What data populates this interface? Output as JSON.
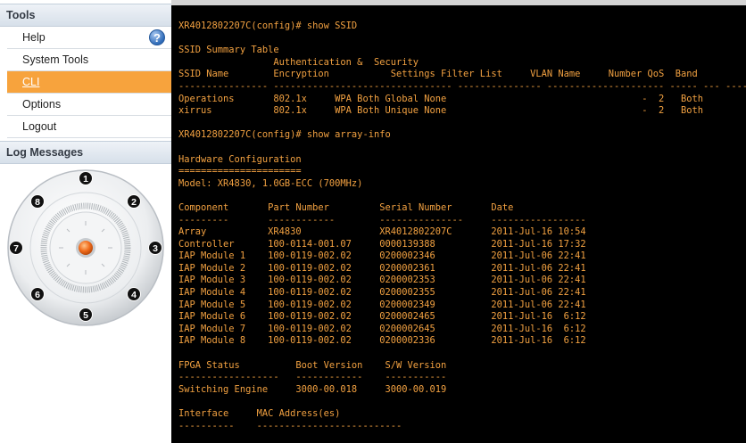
{
  "sidebar": {
    "tools_header": "Tools",
    "menu": [
      {
        "label": "Help"
      },
      {
        "label": "System Tools"
      },
      {
        "label": "CLI"
      },
      {
        "label": "Options"
      },
      {
        "label": "Logout"
      }
    ],
    "log_header": "Log Messages",
    "help_icon_glyph": "?",
    "array_ports": [
      "1",
      "2",
      "3",
      "4",
      "5",
      "6",
      "7",
      "8"
    ]
  },
  "colors": {
    "terminal_bg": "#000000",
    "terminal_fg": "#f2a141",
    "menu_active": "#f7a33d"
  },
  "terminal": {
    "lines": [
      "XR4012802207C(config)# show SSID",
      "",
      "SSID Summary Table",
      "                 Authentication &  Security",
      "SSID Name        Encryption           Settings Filter List     VLAN Name     Number QoS  Band",
      "---------------- -------------------------------- --------------- --------------------- ----- --- ------",
      "Operations       802.1x     WPA Both Global None                                   -  2   Both",
      "xirrus           802.1x     WPA Both Unique None                                   -  2   Both",
      "",
      "XR4012802207C(config)# show array-info",
      "",
      "Hardware Configuration",
      "======================",
      "Model: XR4830, 1.0GB-ECC (700MHz)",
      "",
      "Component       Part Number         Serial Number       Date",
      "---------       ------------        ---------------     -----------------",
      "Array           XR4830              XR4012802207C       2011-Jul-16 10:54",
      "Controller      100-0114-001.07     0000139388          2011-Jul-16 17:32",
      "IAP Module 1    100-0119-002.02     0200002346          2011-Jul-06 22:41",
      "IAP Module 2    100-0119-002.02     0200002361          2011-Jul-06 22:41",
      "IAP Module 3    100-0119-002.02     0200002353          2011-Jul-06 22:41",
      "IAP Module 4    100-0119-002.02     0200002355          2011-Jul-06 22:41",
      "IAP Module 5    100-0119-002.02     0200002349          2011-Jul-06 22:41",
      "IAP Module 6    100-0119-002.02     0200002465          2011-Jul-16  6:12",
      "IAP Module 7    100-0119-002.02     0200002645          2011-Jul-16  6:12",
      "IAP Module 8    100-0119-002.02     0200002336          2011-Jul-16  6:12",
      "",
      "FPGA Status          Boot Version    S/W Version",
      "------------------   ------------    -----------",
      "Switching Engine     3000-00.018     3000-00.019",
      "",
      "Interface     MAC Address(es)",
      "----------    --------------------------"
    ]
  }
}
